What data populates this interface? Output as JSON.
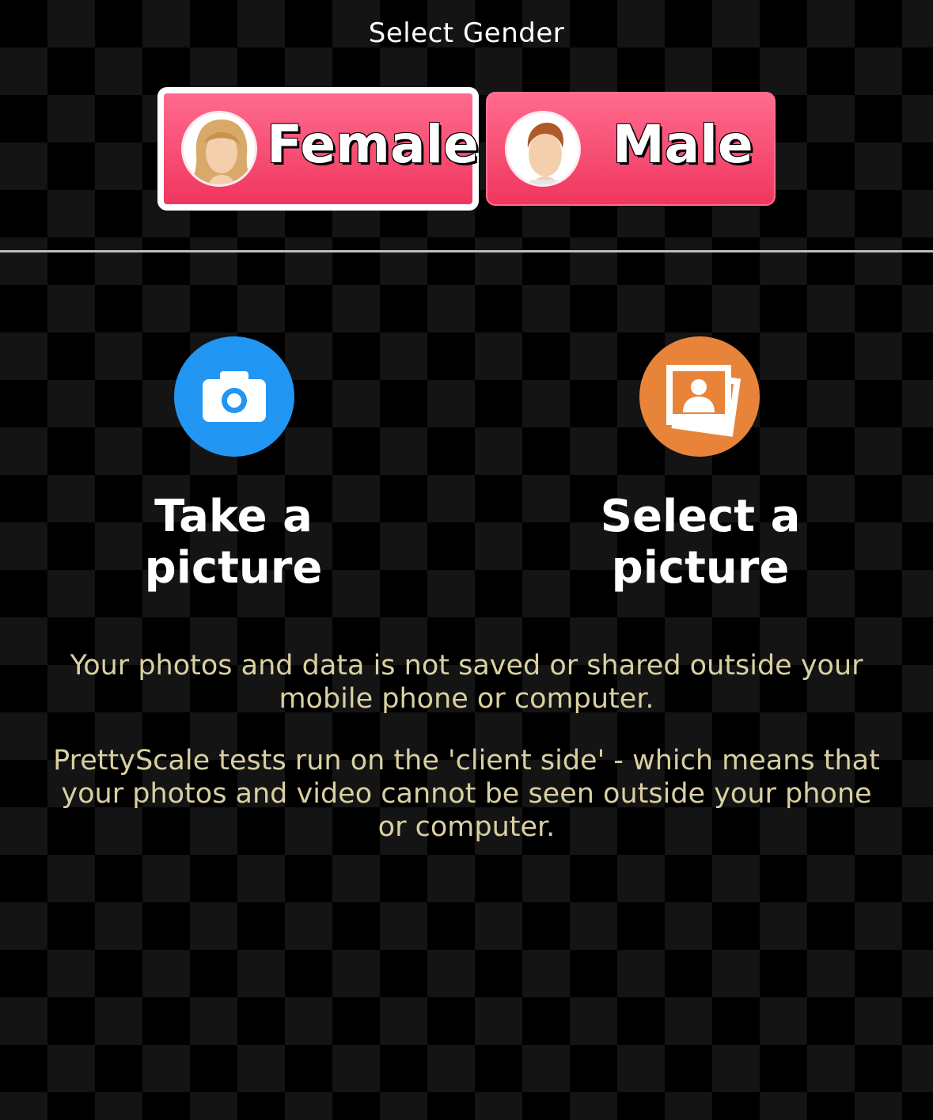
{
  "gender_section": {
    "title": "Select Gender",
    "female_label": "Female",
    "male_label": "Male"
  },
  "actions": {
    "take_label": "Take a picture",
    "select_label": "Select a picture"
  },
  "info": {
    "paragraph1": "Your photos and data is not saved or shared outside your mobile phone or computer.",
    "paragraph2": "PrettyScale tests run on the 'client side' - which means that your photos and video cannot be seen outside your phone or computer."
  },
  "colors": {
    "button_pink": "#f0365e",
    "camera_blue": "#2196f3",
    "gallery_orange": "#e8843a",
    "info_text": "#d9cfa1"
  },
  "icons": [
    "female-avatar-icon",
    "male-avatar-icon",
    "camera-icon",
    "gallery-icon"
  ]
}
